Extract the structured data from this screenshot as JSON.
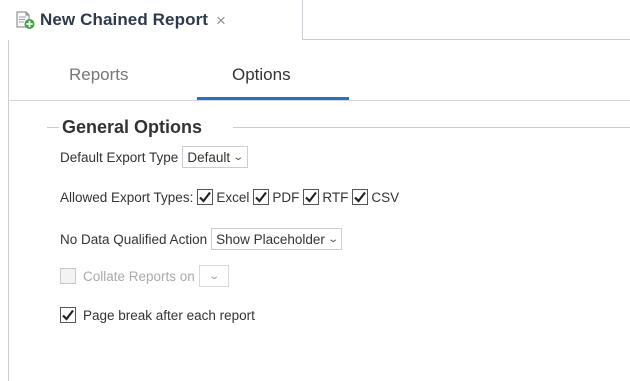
{
  "document_tab": {
    "title": "New Chained Report",
    "close_icon": "×",
    "icon": "new-report-icon"
  },
  "subtabs": [
    {
      "label": "Reports",
      "active": false
    },
    {
      "label": "Options",
      "active": true
    }
  ],
  "general_options": {
    "legend": "General Options",
    "default_export_type": {
      "label": "Default Export Type",
      "value": "Default"
    },
    "allowed_export_types": {
      "label": "Allowed Export Types:",
      "options": [
        {
          "label": "Excel",
          "checked": true
        },
        {
          "label": "PDF",
          "checked": true
        },
        {
          "label": "RTF",
          "checked": true
        },
        {
          "label": "CSV",
          "checked": true
        }
      ]
    },
    "no_data_action": {
      "label": "No Data Qualified Action",
      "value": "Show Placeholder"
    },
    "collate_reports": {
      "label": "Collate Reports on",
      "checked": false,
      "disabled": true,
      "value": ""
    },
    "page_break": {
      "label": "Page break after each report",
      "checked": true
    }
  },
  "colors": {
    "accent": "#2b6fc2",
    "border": "#c9ced4",
    "text": "#333333",
    "disabled_text": "#aaaaaa"
  }
}
